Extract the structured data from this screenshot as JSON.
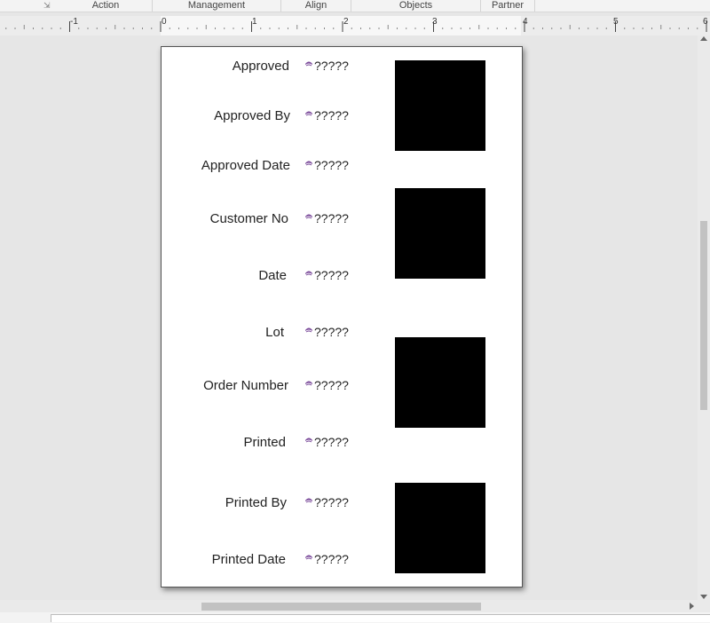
{
  "ribbon": {
    "groups": [
      "Action",
      "Management",
      "Align",
      "Objects",
      "Partner"
    ]
  },
  "ruler": {
    "numbers": [
      "-1",
      "0",
      "1",
      "2",
      "3",
      "4",
      "5",
      "6"
    ]
  },
  "label": {
    "placeholder_value": "?????",
    "fields": [
      {
        "label": "Approved",
        "value": "?????"
      },
      {
        "label": "Approved By",
        "value": "?????"
      },
      {
        "label": "Approved Date",
        "value": "?????"
      },
      {
        "label": "Customer No",
        "value": "?????"
      },
      {
        "label": "Date",
        "value": "?????"
      },
      {
        "label": "Lot",
        "value": "?????"
      },
      {
        "label": "Order Number",
        "value": "?????"
      },
      {
        "label": "Printed",
        "value": "?????"
      },
      {
        "label": "Printed By",
        "value": "?????"
      },
      {
        "label": "Printed Date",
        "value": "?????"
      }
    ]
  },
  "icons": {
    "dialog_launcher": "dialog-launcher-icon",
    "field_value": "data-source-icon"
  },
  "colors": {
    "barcode_fill": "#000000",
    "page_bg": "#ffffff",
    "canvas_bg": "#e6e6e6",
    "icon_accent": "#7a4a9a"
  }
}
